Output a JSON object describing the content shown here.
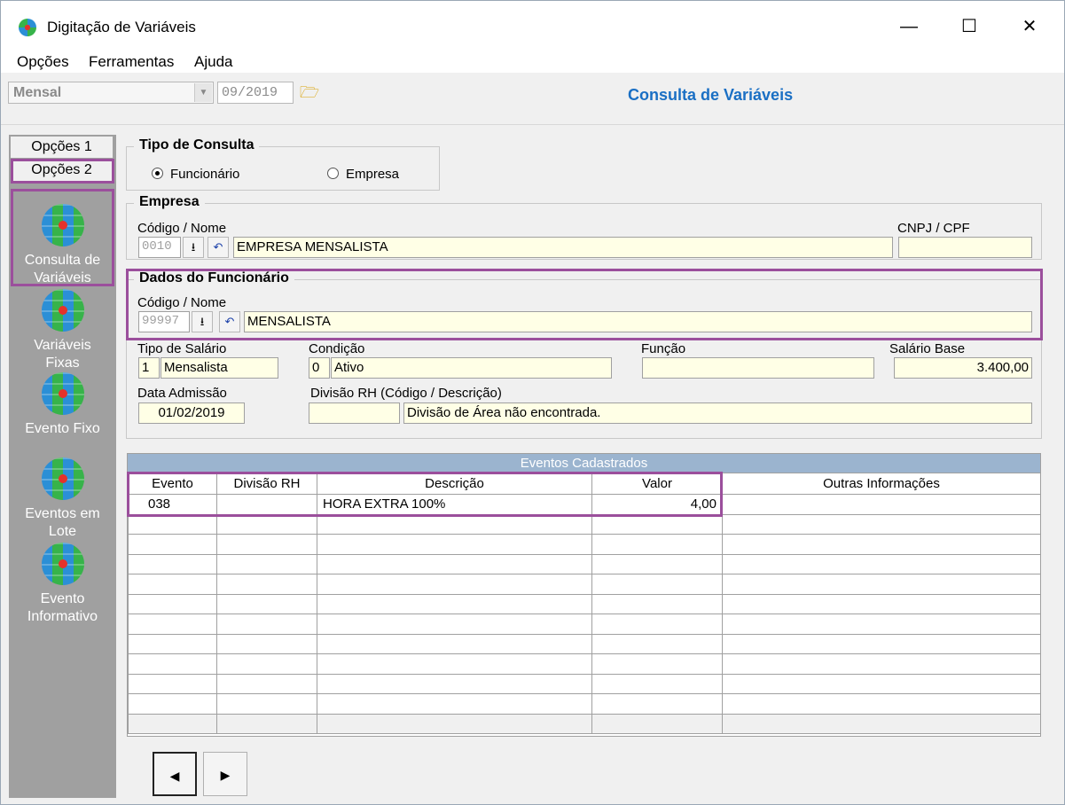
{
  "window": {
    "title": "Digitação de Variáveis",
    "minimize": "—",
    "maximize": "☐",
    "close": "✕"
  },
  "menu": [
    "Opções",
    "Ferramentas",
    "Ajuda"
  ],
  "toolbar": {
    "period_type": "Mensal",
    "period": "09/2019",
    "folder_icon": "folder-open-icon",
    "heading": "Consulta de Variáveis"
  },
  "sidebar": {
    "tabs": [
      "Opções 1",
      "Opções 2"
    ],
    "items": [
      {
        "label1": "Consulta de",
        "label2": "Variáveis"
      },
      {
        "label1": "Variáveis",
        "label2": "Fixas"
      },
      {
        "label1": "Evento Fixo",
        "label2": ""
      },
      {
        "label1": "Eventos em",
        "label2": "Lote"
      },
      {
        "label1": "Evento",
        "label2": "Informativo"
      }
    ]
  },
  "tipo_consulta": {
    "title": "Tipo de Consulta",
    "opt1": "Funcionário",
    "opt2": "Empresa",
    "selected": "Funcionário"
  },
  "empresa": {
    "title": "Empresa",
    "code_label": "Código / Nome",
    "code": "0010",
    "name": "EMPRESA MENSALISTA",
    "cnpj_label": "CNPJ / CPF",
    "cnpj": ""
  },
  "funcionario": {
    "title": "Dados do Funcionário",
    "code_label": "Código / Nome",
    "code": "99997",
    "name": "MENSALISTA",
    "tipo_salario_label": "Tipo de Salário",
    "tipo_salario_code": "1",
    "tipo_salario": "Mensalista",
    "condicao_label": "Condição",
    "condicao_code": "0",
    "condicao": "Ativo",
    "funcao_label": "Função",
    "funcao": "",
    "salario_label": "Salário Base",
    "salario": "3.400,00",
    "admissao_label": "Data Admissão",
    "admissao": "01/02/2019",
    "divisao_label": "Divisão RH (Código / Descrição)",
    "divisao_code": "",
    "divisao_desc": "Divisão de Área não encontrada."
  },
  "eventos": {
    "caption": "Eventos Cadastrados",
    "columns": [
      "Evento",
      "Divisão RH",
      "Descrição",
      "Valor",
      "Outras Informações"
    ],
    "rows": [
      [
        "038",
        "",
        "HORA EXTRA 100%",
        "4,00",
        ""
      ]
    ]
  },
  "nav": {
    "prev": "◀",
    "next": "▶"
  },
  "colors": {
    "accent": "#1a6fc4",
    "highlight": "#9b4f9c",
    "field_bg": "#ffffe6",
    "grid_caption": "#9bb4cf"
  }
}
